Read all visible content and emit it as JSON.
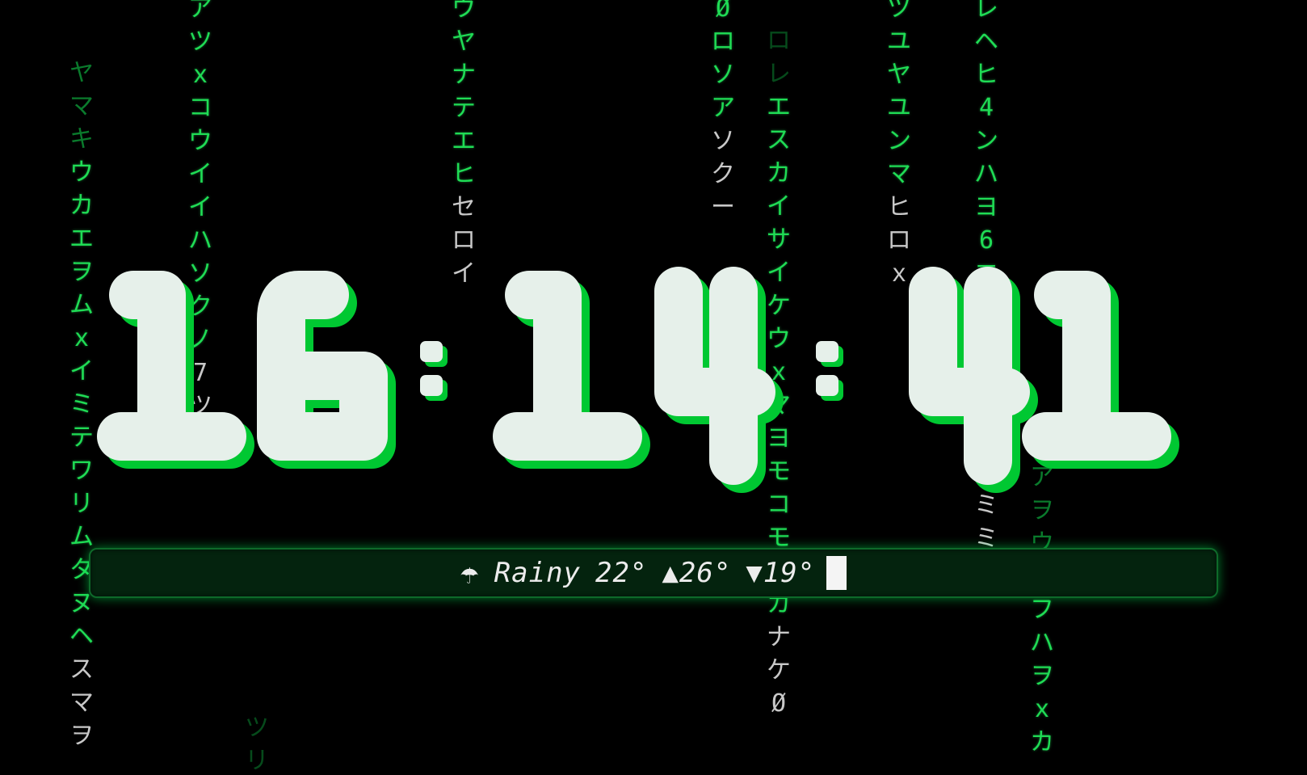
{
  "clock": {
    "hours": "16",
    "minutes": "14",
    "seconds": "41",
    "separator": ":",
    "color": "#e6f0ea",
    "glow_color": "#00c832"
  },
  "weather": {
    "icon": "umbrella-icon",
    "icon_glyph": "☂",
    "condition": "Rainy",
    "temperature": "22°",
    "high": "▲26°",
    "low": "▼19°"
  },
  "rain": {
    "columns": [
      {
        "chars": [
          "ヤ",
          "マ",
          "キ",
          "ウ",
          "カ",
          "エ",
          "ヲ",
          "ム",
          "ｘ",
          "イ",
          "ミ",
          "テ",
          "ワ",
          "リ",
          "ム",
          "タ",
          "ヌ",
          "ヘ",
          "ス",
          "マ",
          "ヲ"
        ]
      },
      {
        "chars": [
          "ア",
          "ツ",
          "ｘ",
          "コ",
          "ウ",
          "イ",
          "イ",
          "ハ",
          "ソ",
          "ク",
          "ノ",
          "7",
          "ツ",
          "ウ"
        ]
      },
      {
        "chars": [
          "ツ",
          "リ"
        ]
      },
      {
        "chars": [
          "ウ",
          "ヤ",
          "ナ",
          "テ",
          "エ",
          "ヒ",
          "セ",
          "ロ",
          "イ"
        ]
      },
      {
        "chars": [
          "Ø",
          "ロ",
          "ソ",
          "ア",
          "ソ",
          "ク",
          "ー"
        ]
      },
      {
        "chars": [
          "ロ",
          "レ",
          "エ",
          "ス",
          "カ",
          "イ",
          "サ",
          "イ",
          "ケ",
          "ウ",
          "ｘ",
          "マ",
          "ヨ",
          "モ",
          "コ",
          "モ",
          "ヌ",
          "カ",
          "ナ",
          "ケ",
          "Ø"
        ]
      },
      {
        "chars": [
          "ツ",
          "ユ",
          "ヤ",
          "ユ",
          "ン",
          "マ",
          "ヒ",
          "ロ",
          "ｘ"
        ]
      },
      {
        "chars": [
          "レ",
          "ヘ",
          "ヒ",
          "4",
          "ン",
          "ハ",
          "ヨ",
          "6",
          "エ",
          "ヘ",
          "ス",
          "ト",
          "ト",
          "ム",
          "ト",
          "ミ",
          "ミ"
        ]
      },
      {
        "chars": [
          "ア",
          "ヲ",
          "ウ",
          "ケ",
          "フ",
          "ハ",
          "ヲ",
          "ｘ",
          "カ"
        ]
      }
    ]
  }
}
